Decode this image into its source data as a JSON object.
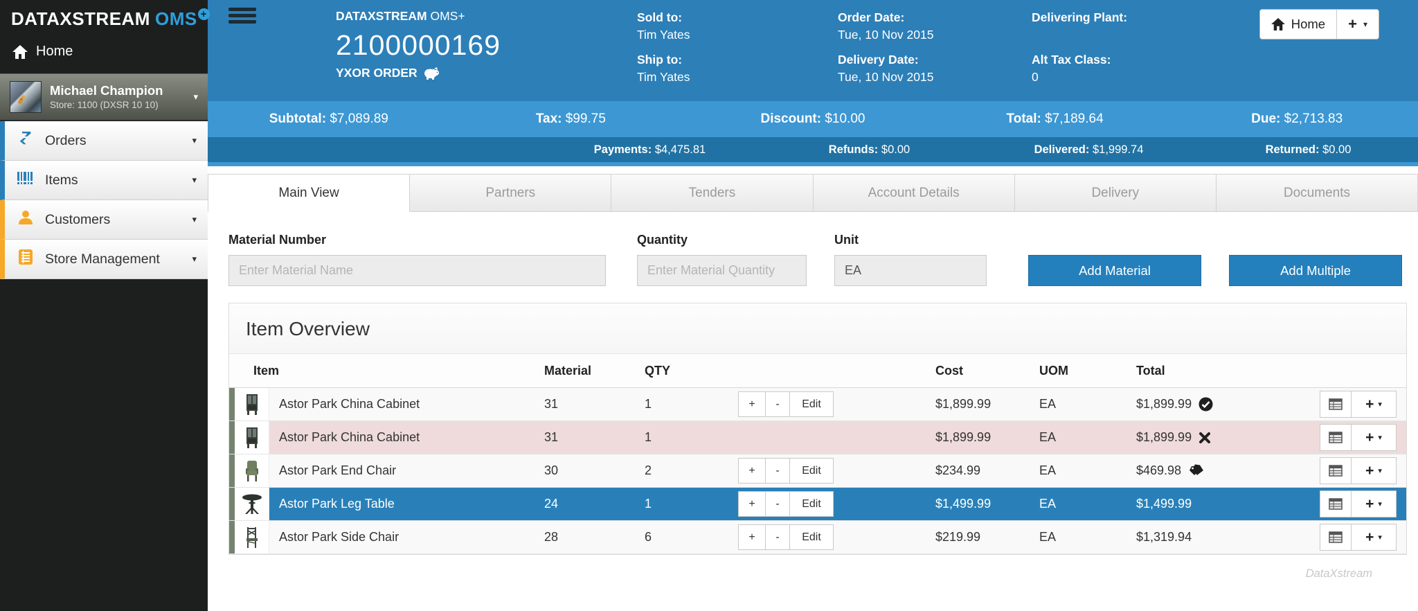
{
  "brand": {
    "name": "DATAXSTREAM",
    "suffix": "OMS",
    "plus": "+"
  },
  "icons": {
    "caret_down": "▾"
  },
  "sidebar": {
    "home_label": "Home",
    "user": {
      "name": "Michael Champion",
      "store": "Store: 1100 (DXSR 10 10)"
    },
    "items": [
      {
        "label": "Orders",
        "icon": "exchange-icon",
        "accent": "#2980b9"
      },
      {
        "label": "Items",
        "icon": "barcode-icon",
        "accent": "#2980b9"
      },
      {
        "label": "Customers",
        "icon": "person-icon",
        "accent": "#f6a828"
      },
      {
        "label": "Store Management",
        "icon": "ledger-icon",
        "accent": "#f6a828"
      }
    ]
  },
  "header": {
    "app_brand": "DATAXSTREAM",
    "app_suffix": "OMS+",
    "order_number": "2100000169",
    "order_type": "YXOR ORDER",
    "home_button": "Home",
    "fields": [
      {
        "label": "Sold to:",
        "value": "Tim Yates"
      },
      {
        "label": "Ship to:",
        "value": "Tim Yates"
      },
      {
        "label": "Order Date:",
        "value": "Tue, 10 Nov 2015"
      },
      {
        "label": "Delivery Date:",
        "value": "Tue, 10 Nov 2015"
      },
      {
        "label": "Delivering Plant:",
        "value": ""
      },
      {
        "label": "Alt Tax Class:",
        "value": "0"
      }
    ]
  },
  "totals": [
    {
      "label": "Subtotal:",
      "value": "$7,089.89"
    },
    {
      "label": "Tax:",
      "value": "$99.75"
    },
    {
      "label": "Discount:",
      "value": "$10.00"
    },
    {
      "label": "Total:",
      "value": "$7,189.64"
    },
    {
      "label": "Due:",
      "value": "$2,713.83"
    }
  ],
  "payments": [
    {
      "label": "Payments:",
      "value": "$4,475.81"
    },
    {
      "label": "Refunds:",
      "value": "$0.00"
    },
    {
      "label": "Delivered:",
      "value": "$1,999.74"
    },
    {
      "label": "Returned:",
      "value": "$0.00"
    }
  ],
  "tabs": [
    {
      "label": "Main View",
      "active": true
    },
    {
      "label": "Partners",
      "active": false
    },
    {
      "label": "Tenders",
      "active": false
    },
    {
      "label": "Account Details",
      "active": false
    },
    {
      "label": "Delivery",
      "active": false
    },
    {
      "label": "Documents",
      "active": false
    }
  ],
  "form": {
    "material_label": "Material Number",
    "material_placeholder": "Enter Material Name",
    "quantity_label": "Quantity",
    "quantity_placeholder": "Enter Material Quantity",
    "unit_label": "Unit",
    "unit_value": "EA",
    "add_material": "Add Material",
    "add_multiple": "Add Multiple"
  },
  "item_overview": {
    "title": "Item Overview",
    "columns": [
      "Item",
      "Material",
      "QTY",
      "Cost",
      "UOM",
      "Total"
    ],
    "stepper": {
      "plus": "+",
      "minus": "-",
      "edit": "Edit"
    },
    "rows": [
      {
        "name": "Astor Park China Cabinet",
        "material": "31",
        "qty": "1",
        "cost": "$1,899.99",
        "uom": "EA",
        "total": "$1,899.99",
        "status": "check-circle",
        "state": "normal"
      },
      {
        "name": "Astor Park China Cabinet",
        "material": "31",
        "qty": "1",
        "cost": "$1,899.99",
        "uom": "EA",
        "total": "$1,899.99",
        "status": "x-mark",
        "state": "rejected"
      },
      {
        "name": "Astor Park End Chair",
        "material": "30",
        "qty": "2",
        "cost": "$234.99",
        "uom": "EA",
        "total": "$469.98",
        "status": "tags",
        "state": "normal"
      },
      {
        "name": "Astor Park Leg Table",
        "material": "24",
        "qty": "1",
        "cost": "$1,499.99",
        "uom": "EA",
        "total": "$1,499.99",
        "status": "",
        "state": "selected"
      },
      {
        "name": "Astor Park Side Chair",
        "material": "28",
        "qty": "6",
        "cost": "$219.99",
        "uom": "EA",
        "total": "$1,319.94",
        "status": "",
        "state": "normal"
      }
    ]
  },
  "watermark": "DataXstream"
}
